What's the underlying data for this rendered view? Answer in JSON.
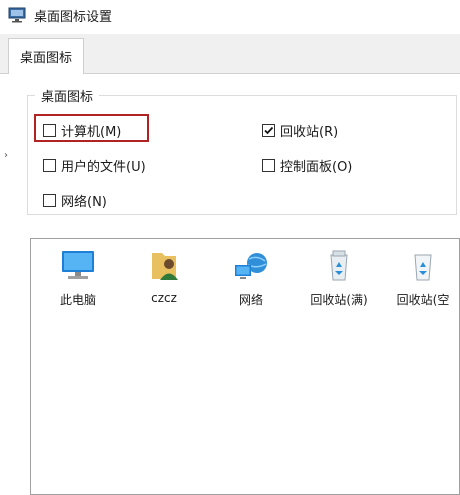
{
  "window": {
    "title": "桌面图标设置",
    "icon": "desktop-settings-icon"
  },
  "tabs": [
    {
      "label": "桌面图标",
      "active": true
    }
  ],
  "group": {
    "legend": "桌面图标",
    "checkboxes": [
      {
        "label": "计算机(M)",
        "checked": false,
        "highlighted": true
      },
      {
        "label": "回收站(R)",
        "checked": true
      },
      {
        "label": "用户的文件(U)",
        "checked": false
      },
      {
        "label": "控制面板(O)",
        "checked": false
      },
      {
        "label": "网络(N)",
        "checked": false
      }
    ]
  },
  "icons": [
    {
      "label": "此电脑",
      "icon": "computer-icon"
    },
    {
      "label": "czcz",
      "icon": "user-folder-icon"
    },
    {
      "label": "网络",
      "icon": "network-icon"
    },
    {
      "label": "回收站(满)",
      "icon": "recycle-bin-full-icon"
    },
    {
      "label": "回收站(空",
      "icon": "recycle-bin-empty-icon"
    }
  ],
  "colors": {
    "highlight": "#b22222",
    "tabstrip": "#f0f0f0"
  }
}
